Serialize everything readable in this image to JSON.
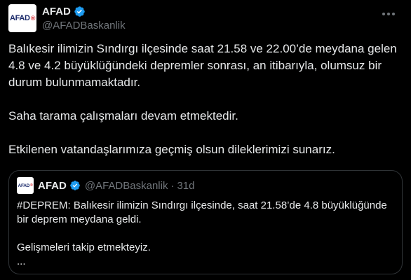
{
  "tweet": {
    "author": {
      "display_name": "AFAD",
      "handle": "@AFADBaskanlik",
      "avatar_text": "AFAD",
      "verified_icon": "verified-badge-icon"
    },
    "more_icon": "more-options-icon",
    "text": {
      "p1": "Balıkesir ilimizin Sındırgı ilçesinde saat 21.58 ve 22.00’de meydana gelen 4.8 ve 4.2 büyüklüğündeki depremler sonrası, an itibarıyla, olumsuz bir durum bulunmamaktadır.",
      "p2": "Saha tarama çalışmaları devam etmektedir.",
      "p3": "Etkilenen vatandaşlarımıza geçmiş olsun dileklerimizi sunarız."
    }
  },
  "quote": {
    "author": {
      "display_name": "AFAD",
      "handle": "@AFADBaskanlik",
      "avatar_text": "AFAD"
    },
    "separator": "·",
    "time": "31d",
    "text": {
      "p1": "#DEPREM: Balıkesir ilimizin Sındırgı ilçesinde, saat 21.58’de 4.8 büyüklüğünde bir deprem meydana geldi.",
      "p2": "Gelişmeleri takip etmekteyiz.",
      "p3": "..."
    }
  },
  "colors": {
    "background": "#000000",
    "text_primary": "#e7e9ea",
    "text_secondary": "#71767b",
    "verified": "#1d9bf0",
    "border": "#2f3336"
  }
}
